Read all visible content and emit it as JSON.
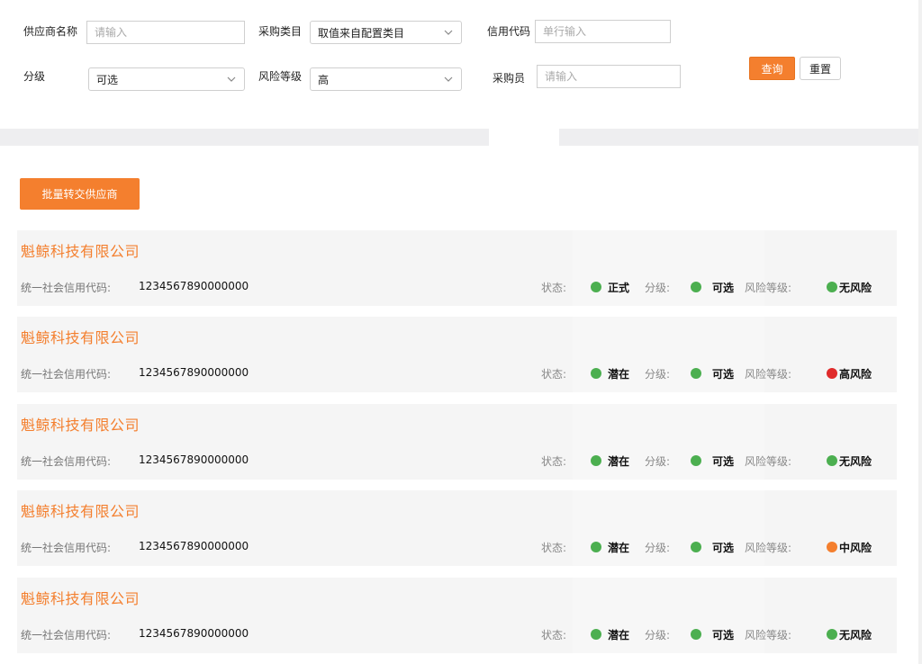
{
  "filters": {
    "supplier_name": {
      "label": "供应商名称",
      "placeholder": "请输入"
    },
    "category": {
      "label": "采购类目",
      "value": "取值来自配置类目"
    },
    "credit_code": {
      "label": "信用代码",
      "placeholder": "单行输入"
    },
    "grade": {
      "label": "分级",
      "value": "可选"
    },
    "risk_level": {
      "label": "风险等级",
      "value": "高"
    },
    "buyer": {
      "label": "采购员",
      "placeholder": "请输入"
    },
    "query_label": "查询",
    "reset_label": "重置"
  },
  "batch_transfer_label": "批量转交供应商",
  "labels": {
    "credit": "统一社会信用代码:",
    "status": "状态:",
    "grade": "分级:",
    "risk": "风险等级:"
  },
  "colors": {
    "accent": "#f47f2e",
    "green": "#4caf50",
    "red": "#e02b2b",
    "orange": "#f47f2e"
  },
  "suppliers": [
    {
      "name": "魁鲸科技有限公司",
      "credit_code": "1234567890000000",
      "status": "正式",
      "status_color": "#4caf50",
      "grade": "可选",
      "grade_color": "#4caf50",
      "risk": "无风险",
      "risk_color": "#4caf50"
    },
    {
      "name": "魁鲸科技有限公司",
      "credit_code": "1234567890000000",
      "status": "潜在",
      "status_color": "#4caf50",
      "grade": "可选",
      "grade_color": "#4caf50",
      "risk": "高风险",
      "risk_color": "#e02b2b"
    },
    {
      "name": "魁鲸科技有限公司",
      "credit_code": "1234567890000000",
      "status": "潜在",
      "status_color": "#4caf50",
      "grade": "可选",
      "grade_color": "#4caf50",
      "risk": "无风险",
      "risk_color": "#4caf50"
    },
    {
      "name": "魁鲸科技有限公司",
      "credit_code": "1234567890000000",
      "status": "潜在",
      "status_color": "#4caf50",
      "grade": "可选",
      "grade_color": "#4caf50",
      "risk": "中风险",
      "risk_color": "#f47f2e"
    },
    {
      "name": "魁鲸科技有限公司",
      "credit_code": "1234567890000000",
      "status": "潜在",
      "status_color": "#4caf50",
      "grade": "可选",
      "grade_color": "#4caf50",
      "risk": "无风险",
      "risk_color": "#4caf50"
    }
  ]
}
